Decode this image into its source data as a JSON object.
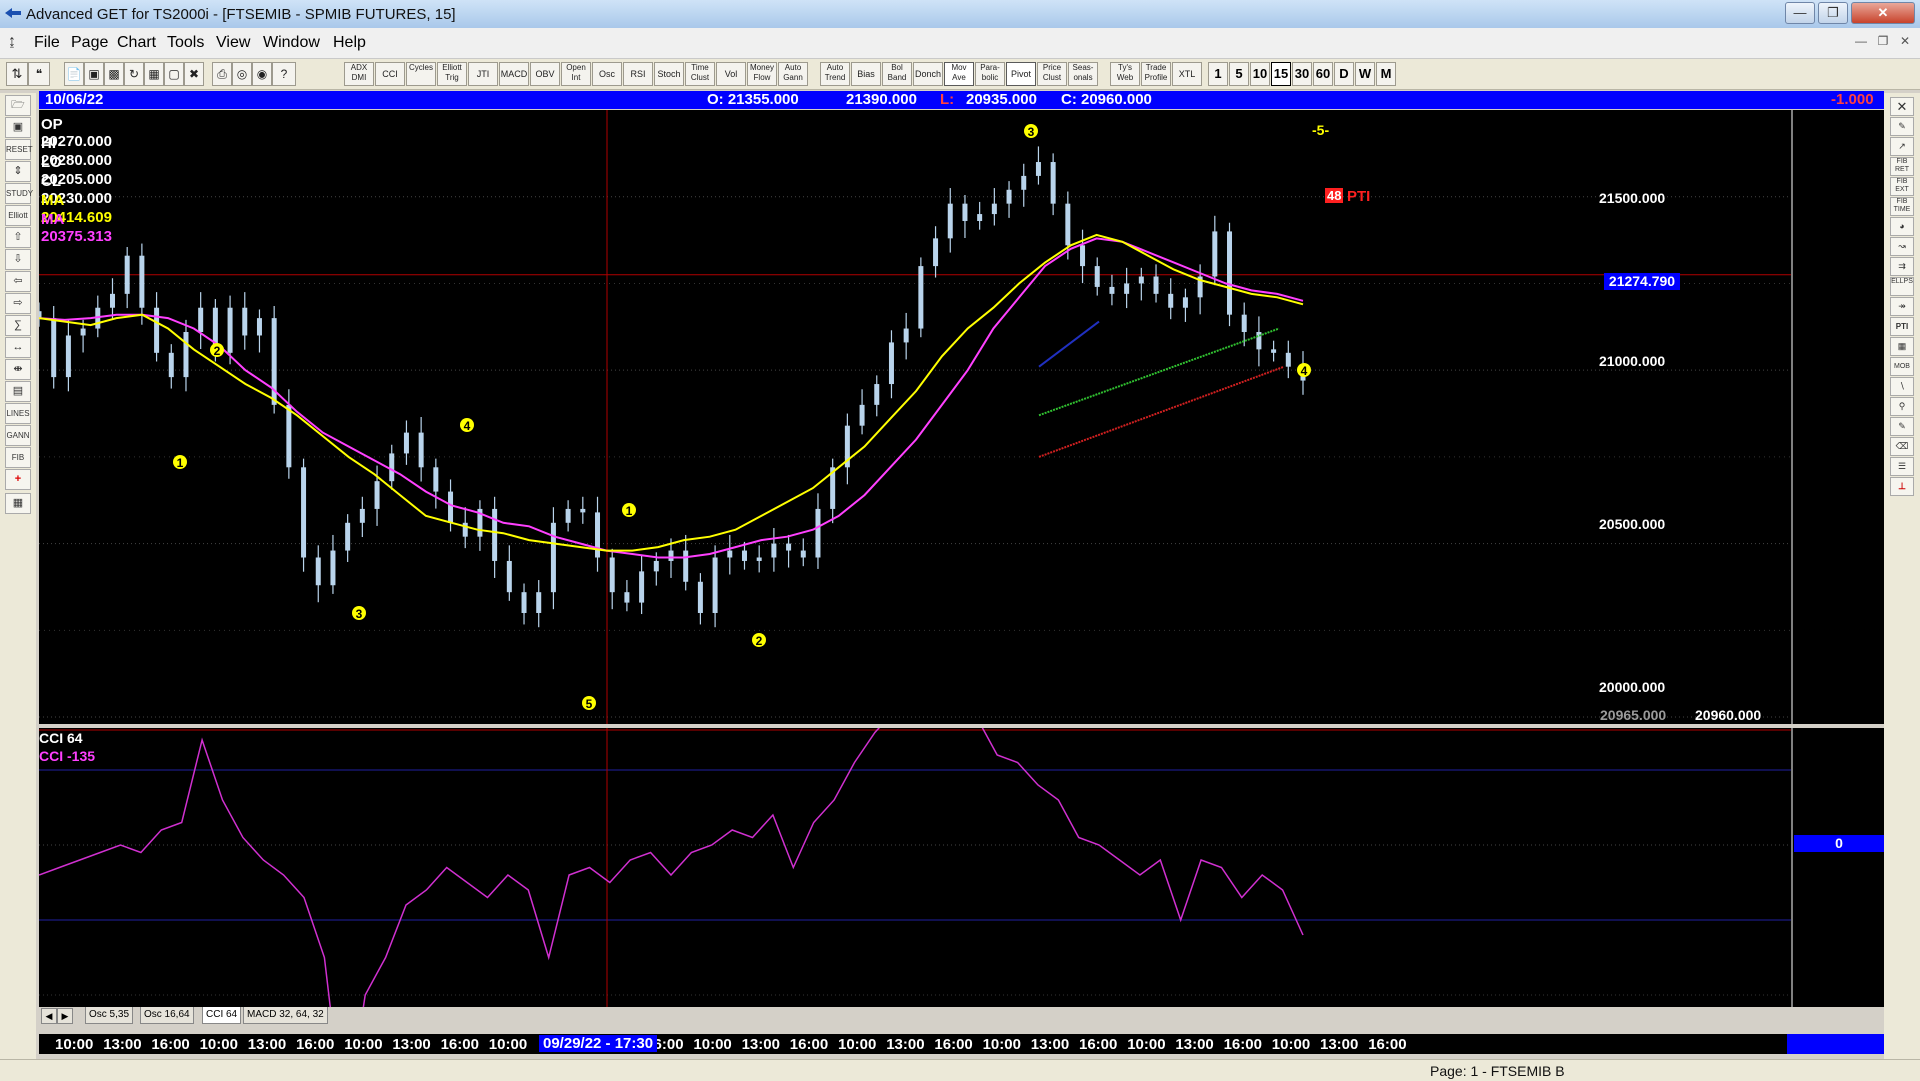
{
  "window": {
    "title": "Advanced GET for TS2000i - [FTSEMIB - SPMIB FUTURES, 15]"
  },
  "menu": [
    "File",
    "Page",
    "Chart",
    "Tools",
    "View",
    "Window",
    "Help"
  ],
  "toolbar": {
    "studies": [
      "ADX DMI",
      "CCI",
      "Cycles",
      "Elliott Trig",
      "JTI",
      "MACD",
      "OBV",
      "Open Int",
      "Osc",
      "RSI",
      "Stoch",
      "Time Clust",
      "Vol",
      "Money Flow",
      "Auto Gann",
      "Auto Trend",
      "Bias",
      "Bol Band",
      "Donch",
      "Mov Ave",
      "Para-bolic",
      "Pivot",
      "Price Clust",
      "Seas-onals",
      "Ty's Web",
      "Trade Profile",
      "XTL"
    ],
    "active_studies": [
      "Mov Ave",
      "Pivot"
    ],
    "timeframes": [
      "1",
      "5",
      "10",
      "15",
      "30",
      "60",
      "D",
      "W",
      "M"
    ],
    "active_timeframe": "15"
  },
  "infobar": {
    "date": "10/06/22",
    "open": "O: 21355.000",
    "high": "21390.000",
    "low_label": "L:",
    "low": "20935.000",
    "close": "C: 20960.000",
    "change": "-1.000"
  },
  "ohlc_panel": [
    {
      "label": "OP",
      "value": "20270.000",
      "color": "#ffffff"
    },
    {
      "label": "HI",
      "value": "20280.000",
      "color": "#ffffff"
    },
    {
      "label": "LO",
      "value": "20205.000",
      "color": "#ffffff"
    },
    {
      "label": "CL",
      "value": "20230.000",
      "color": "#ffffff"
    },
    {
      "label": "MA",
      "value": "20414.609",
      "color": "#ffff00"
    },
    {
      "label": "MA",
      "value": "20375.313",
      "color": "#ff40ff"
    }
  ],
  "price_axis": {
    "ticks": [
      "21500.000",
      "21000.000",
      "20500.000",
      "20000.000"
    ],
    "cursor_price": "21274.790",
    "bottom_left": "20965.000",
    "bottom_right": "20960.000"
  },
  "annotations": {
    "wave_count": "-5-",
    "pti_value": "48",
    "pti_label": "PTI"
  },
  "oscillator": {
    "title": "CCI 64",
    "reading": "CCI  -135",
    "zero_label": "0"
  },
  "osc_tabs": [
    "Osc 5,35",
    "Osc 16,64",
    "CCI 64",
    "MACD 32, 64, 32"
  ],
  "active_osc_tab": "CCI 64",
  "time_axis": {
    "labels": [
      "10:00",
      "13:00",
      "16:00",
      "10:00",
      "13:00",
      "16:00",
      "10:00",
      "13:00",
      "16:00",
      "10:00",
      "13:00",
      "16:00",
      "10:00",
      "13:00",
      "16:00",
      "10:00",
      "13:00",
      "16:00",
      "10:00",
      "13:00",
      "16:00",
      "10:00",
      "13:00",
      "16:00",
      "10:00",
      "13:00",
      "16:00"
    ],
    "cursor_label": "09/29/22 - 17:30"
  },
  "status": {
    "page": "Page: 1 - FTSEMIB B"
  },
  "chart_data": {
    "type": "candlestick",
    "symbol": "FTSEMIB - SPMIB FUTURES",
    "interval": "15",
    "ylim": [
      19980,
      21750
    ],
    "close_series": [
      21150,
      20980,
      21100,
      21120,
      21180,
      21220,
      21330,
      21180,
      21050,
      20980,
      21110,
      21180,
      21050,
      21180,
      21100,
      21150,
      20900,
      20720,
      20460,
      20380,
      20480,
      20560,
      20600,
      20680,
      20760,
      20820,
      20720,
      20650,
      20560,
      20520,
      20600,
      20450,
      20360,
      20300,
      20360,
      20560,
      20600,
      20590,
      20460,
      20360,
      20330,
      20420,
      20450,
      20480,
      20390,
      20300,
      20460,
      20480,
      20450,
      20460,
      20500,
      20480,
      20460,
      20600,
      20720,
      20840,
      20900,
      20960,
      21080,
      21120,
      21300,
      21380,
      21480,
      21430,
      21450,
      21480,
      21520,
      21560,
      21600,
      21480,
      21360,
      21300,
      21240,
      21220,
      21250,
      21270,
      21220,
      21180,
      21210,
      21270,
      21400,
      21160,
      21110,
      21060,
      21050,
      21010,
      20970
    ],
    "ma_yellow": [
      21150,
      21140,
      21130,
      21150,
      21160,
      21120,
      21060,
      21010,
      20960,
      20920,
      20870,
      20810,
      20750,
      20700,
      20640,
      20580,
      20560,
      20540,
      20530,
      20510,
      20500,
      20490,
      20480,
      20480,
      20490,
      20510,
      20520,
      20540,
      20580,
      20620,
      20660,
      20720,
      20780,
      20860,
      20940,
      21040,
      21120,
      21180,
      21250,
      21310,
      21360,
      21390,
      21370,
      21330,
      21290,
      21260,
      21240,
      21220,
      21210,
      21190
    ],
    "ma_magenta": [
      21150,
      21145,
      21150,
      21160,
      21160,
      21150,
      21120,
      21070,
      21000,
      20950,
      20880,
      20820,
      20780,
      20740,
      20700,
      20650,
      20610,
      20590,
      20560,
      20550,
      20520,
      20500,
      20480,
      20470,
      20460,
      20460,
      20470,
      20490,
      20510,
      20520,
      20540,
      20580,
      20640,
      20720,
      20800,
      20900,
      21000,
      21120,
      21210,
      21300,
      21350,
      21380,
      21370,
      21340,
      21310,
      21280,
      21250,
      21230,
      21220,
      21200
    ],
    "cci_series": [
      -40,
      -30,
      -20,
      -10,
      0,
      -10,
      20,
      30,
      140,
      60,
      10,
      -20,
      -40,
      -70,
      -150,
      -380,
      -200,
      -150,
      -80,
      -60,
      -30,
      -50,
      -70,
      -40,
      -60,
      -150,
      -40,
      -30,
      -50,
      -20,
      -10,
      -40,
      -10,
      0,
      20,
      10,
      40,
      -30,
      30,
      60,
      110,
      150,
      180,
      250,
      330,
      250,
      170,
      120,
      110,
      80,
      60,
      10,
      0,
      -20,
      -40,
      -20,
      -100,
      -20,
      -30,
      -70,
      -40,
      -60,
      -120
    ]
  }
}
